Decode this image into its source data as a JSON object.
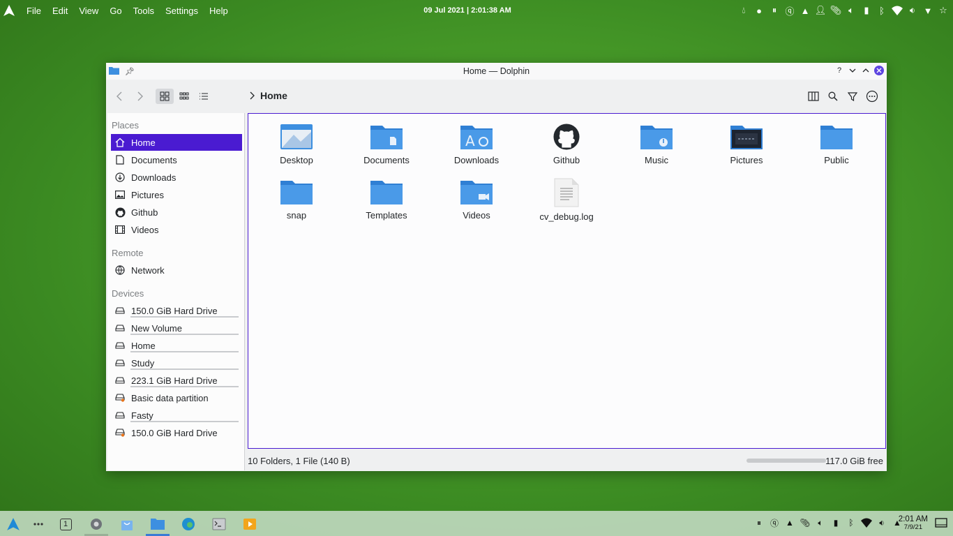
{
  "topbar": {
    "menus": [
      "File",
      "Edit",
      "View",
      "Go",
      "Tools",
      "Settings",
      "Help"
    ],
    "clock": "09 Jul 2021 | 2:01:38 AM"
  },
  "window": {
    "title": "Home — Dolphin",
    "help_glyph": "?",
    "breadcrumb": "Home"
  },
  "sidebar": {
    "places_header": "Places",
    "places": [
      {
        "label": "Home",
        "icon": "home-icon"
      },
      {
        "label": "Documents",
        "icon": "document-icon"
      },
      {
        "label": "Downloads",
        "icon": "download-icon"
      },
      {
        "label": "Pictures",
        "icon": "image-icon"
      },
      {
        "label": "Github",
        "icon": "github-icon"
      },
      {
        "label": "Videos",
        "icon": "film-icon"
      }
    ],
    "remote_header": "Remote",
    "remote": [
      {
        "label": "Network",
        "icon": "globe-icon"
      }
    ],
    "devices_header": "Devices",
    "devices": [
      {
        "label": "150.0 GiB Hard Drive",
        "usage": 0.2
      },
      {
        "label": "New Volume",
        "usage": 0.94
      },
      {
        "label": "Home",
        "usage": 0.92
      },
      {
        "label": "Study",
        "usage": 0.95
      },
      {
        "label": "223.1 GiB Hard Drive",
        "usage": 0.65
      },
      {
        "label": "Basic data partition",
        "usage": null
      },
      {
        "label": "Fasty",
        "usage": 0.02
      },
      {
        "label": "150.0 GiB Hard Drive",
        "usage": null
      }
    ]
  },
  "files": [
    {
      "label": "Desktop",
      "icon": "desktop-folder-icon"
    },
    {
      "label": "Documents",
      "icon": "documents-folder-icon"
    },
    {
      "label": "Downloads",
      "icon": "downloads-folder-icon"
    },
    {
      "label": "Github",
      "icon": "github-icon"
    },
    {
      "label": "Music",
      "icon": "music-folder-icon"
    },
    {
      "label": "Pictures",
      "icon": "pictures-folder-icon"
    },
    {
      "label": "Public",
      "icon": "folder-icon"
    },
    {
      "label": "snap",
      "icon": "folder-icon"
    },
    {
      "label": "Templates",
      "icon": "folder-icon"
    },
    {
      "label": "Videos",
      "icon": "videos-folder-icon"
    },
    {
      "label": "cv_debug.log",
      "icon": "text-file-icon"
    }
  ],
  "statusbar": {
    "summary": "10 Folders, 1 File (140 B)",
    "free": "117.0 GiB free",
    "used_fraction": 0.19
  },
  "taskbar": {
    "desktop_number": "1",
    "time": "2:01 AM",
    "date": "7/9/21"
  },
  "colors": {
    "accent": "#4a1bd1",
    "folder": "#3d8fe0",
    "close": "#5d45e0"
  }
}
